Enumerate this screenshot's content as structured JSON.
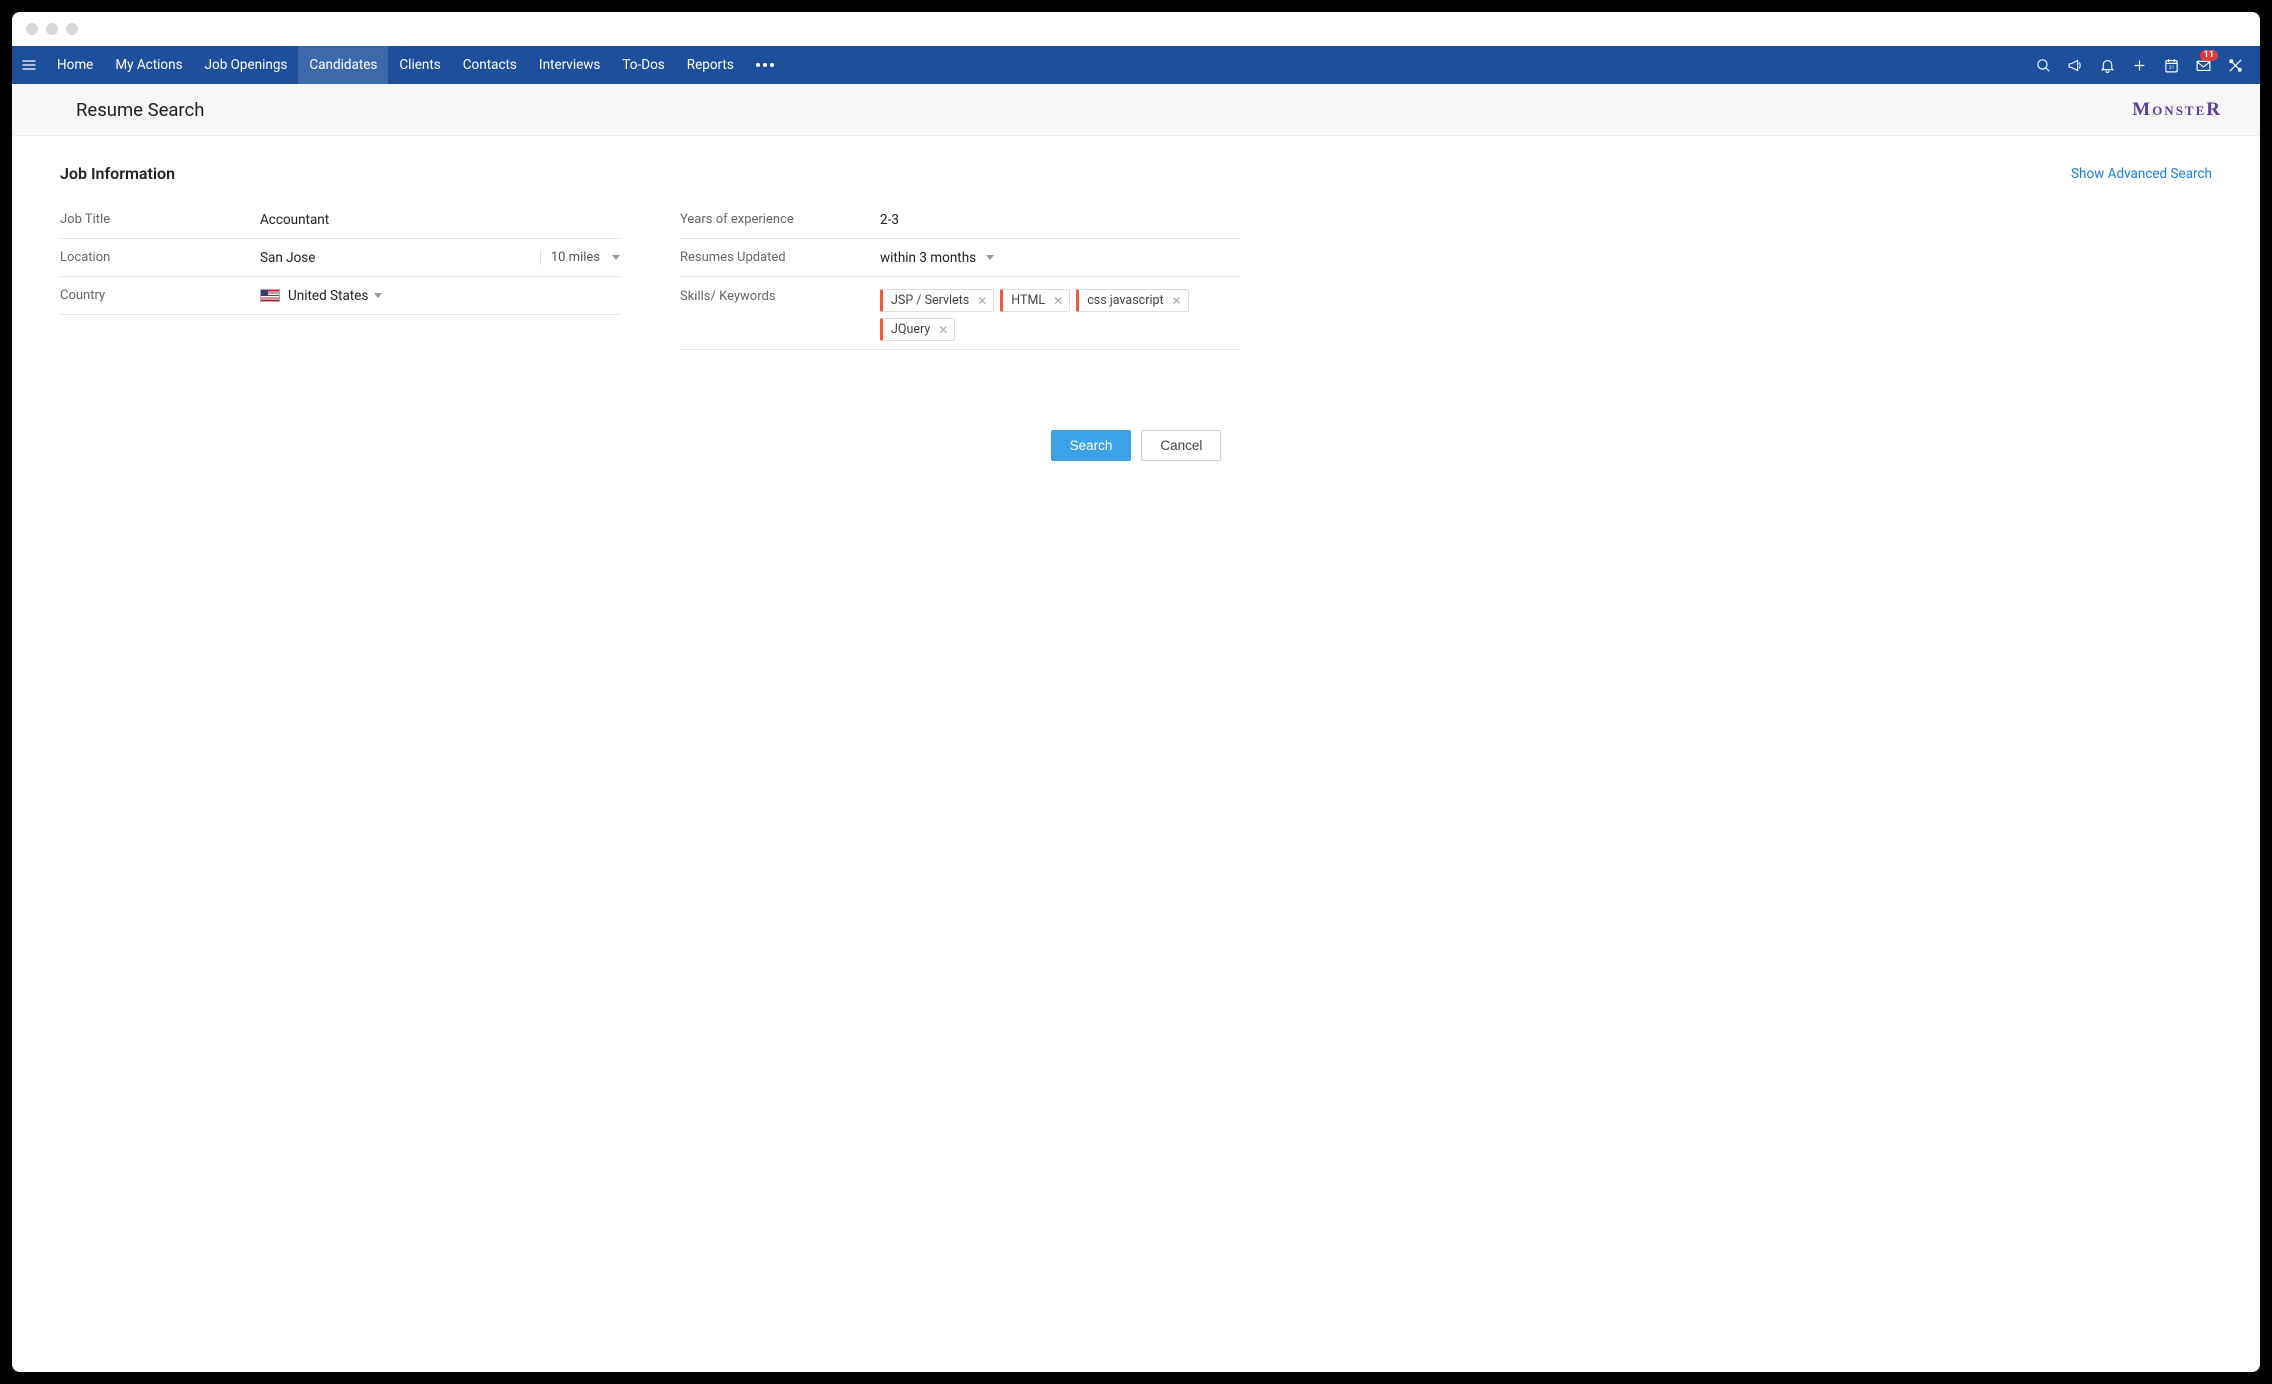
{
  "nav": {
    "items": [
      {
        "label": "Home",
        "active": false
      },
      {
        "label": "My Actions",
        "active": false
      },
      {
        "label": "Job Openings",
        "active": false
      },
      {
        "label": "Candidates",
        "active": true
      },
      {
        "label": "Clients",
        "active": false
      },
      {
        "label": "Contacts",
        "active": false
      },
      {
        "label": "Interviews",
        "active": false
      },
      {
        "label": "To-Dos",
        "active": false
      },
      {
        "label": "Reports",
        "active": false
      }
    ],
    "mail_badge": "11"
  },
  "page": {
    "title": "Resume Search",
    "brand": "MonsteR"
  },
  "section": {
    "title": "Job Information",
    "advanced_link": "Show Advanced Search"
  },
  "form": {
    "job_title_label": "Job Title",
    "job_title_value": "Accountant",
    "location_label": "Location",
    "location_value": "San Jose",
    "radius_value": "10 miles",
    "country_label": "Country",
    "country_value": "United States",
    "years_label": "Years of experience",
    "years_value": "2-3",
    "updated_label": "Resumes Updated",
    "updated_value": "within 3 months",
    "skills_label": "Skills/ Keywords",
    "skills": [
      "JSP / Servlets",
      "HTML",
      "css javascript",
      "JQuery"
    ]
  },
  "actions": {
    "search": "Search",
    "cancel": "Cancel"
  }
}
